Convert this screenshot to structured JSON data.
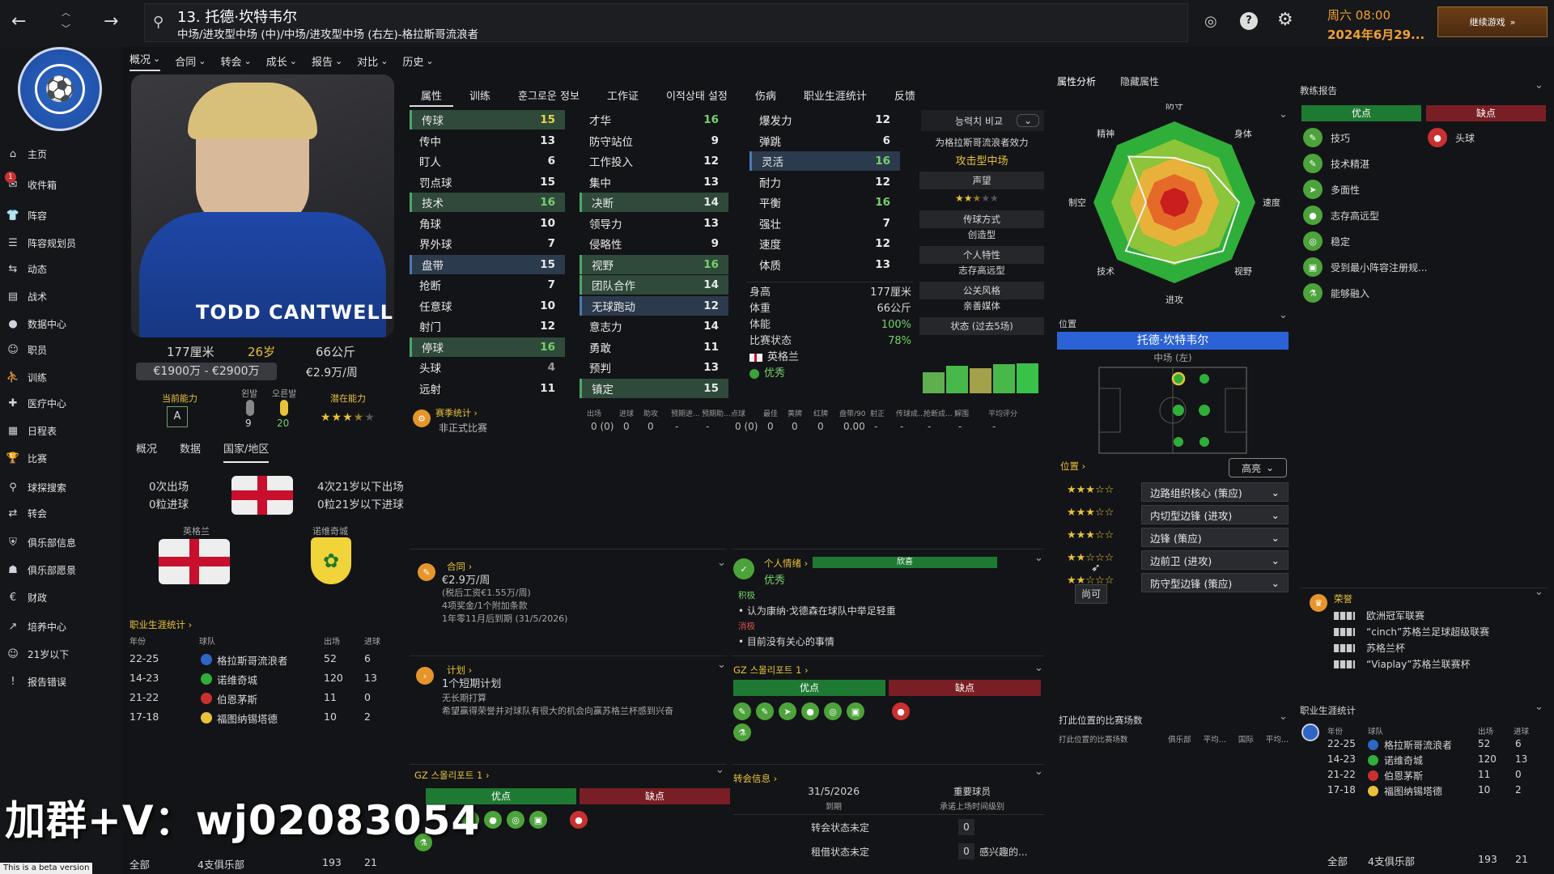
{
  "header": {
    "player_title": "13. 托德·坎特韦尔",
    "player_subtitle": "中场/进攻型中场 (中)/中场/进攻型中场 (右左)-格拉斯哥流浪者",
    "date_line1": "周六 08:00",
    "date_line2": "2024年6月29...",
    "continue_label": "继续游戏"
  },
  "nav": {
    "items": [
      "主页",
      "收件箱",
      "阵容",
      "阵容规划员",
      "动态",
      "战术",
      "数据中心",
      "职员",
      "训练",
      "医疗中心",
      "日程表",
      "比赛",
      "球探搜索",
      "转会",
      "俱乐部信息",
      "俱乐部愿景",
      "财政",
      "培养中心",
      "21岁以下",
      "报告错误"
    ],
    "inbox_badge": "1"
  },
  "menu": [
    "概况",
    "合同",
    "转会",
    "成长",
    "报告",
    "对比",
    "历史"
  ],
  "profile": {
    "height": "177厘米",
    "age": "26岁",
    "weight": "66公斤",
    "value": "€1900万 - €2900万",
    "wage": "€2.9万/周",
    "current_ability_label": "当前能力",
    "current_ability": "A",
    "left_foot_label": "왼발",
    "right_foot_label": "오른발",
    "left_foot": "9",
    "right_foot": "20",
    "potential_label": "潜在能力",
    "potential_stars": 3.5,
    "shirt_name": "TODD CANTWELL"
  },
  "subtabs": [
    "概况",
    "数据",
    "国家/地区"
  ],
  "intl": {
    "caps": "0次出场",
    "goals": "0粒进球",
    "u21_caps": "4次21岁以下出场",
    "u21_goals": "0粒21岁以下进球",
    "nation": "英格兰",
    "prev_club": "诺维奇城"
  },
  "career_left": {
    "title": "职业生涯统计",
    "headers": [
      "年份",
      "球队",
      "出场",
      "进球"
    ],
    "rows": [
      [
        "22-25",
        "格拉斯哥流浪者",
        "52",
        "6"
      ],
      [
        "14-23",
        "诺维奇城",
        "120",
        "13"
      ],
      [
        "21-22",
        "伯恩茅斯",
        "11",
        "0"
      ],
      [
        "17-18",
        "福图纳锡塔德",
        "10",
        "2"
      ]
    ],
    "total": [
      "全部",
      "4支俱乐部",
      "193",
      "21"
    ]
  },
  "attr_tabs": [
    "属性",
    "训练",
    "훈그로운 정보",
    "工作证",
    "이적상태 설정",
    "伤病",
    "职业生涯统计",
    "反馈"
  ],
  "tech": [
    [
      "传球",
      "15",
      "y"
    ],
    [
      "传中",
      "13",
      "w"
    ],
    [
      "盯人",
      "6",
      "w"
    ],
    [
      "罚点球",
      "15",
      "w"
    ],
    [
      "技术",
      "16",
      "g"
    ],
    [
      "角球",
      "10",
      "w"
    ],
    [
      "界外球",
      "7",
      "w"
    ],
    [
      "盘带",
      "15",
      "w"
    ],
    [
      "抢断",
      "7",
      "w"
    ],
    [
      "任意球",
      "10",
      "w"
    ],
    [
      "射门",
      "12",
      "w"
    ],
    [
      "停球",
      "16",
      "g"
    ],
    [
      "头球",
      "4",
      "gr"
    ],
    [
      "远射",
      "11",
      "w"
    ]
  ],
  "mental": [
    [
      "才华",
      "16",
      "g"
    ],
    [
      "防守站位",
      "9",
      "w"
    ],
    [
      "工作投入",
      "12",
      "w"
    ],
    [
      "集中",
      "13",
      "w"
    ],
    [
      "决断",
      "14",
      "w"
    ],
    [
      "领导力",
      "13",
      "w"
    ],
    [
      "侵略性",
      "9",
      "w"
    ],
    [
      "视野",
      "16",
      "g"
    ],
    [
      "团队合作",
      "14",
      "w"
    ],
    [
      "无球跑动",
      "12",
      "w"
    ],
    [
      "意志力",
      "14",
      "w"
    ],
    [
      "勇敢",
      "11",
      "w"
    ],
    [
      "预判",
      "13",
      "w"
    ],
    [
      "镇定",
      "15",
      "w"
    ]
  ],
  "physical": [
    [
      "爆发力",
      "12",
      "w"
    ],
    [
      "弹跳",
      "6",
      "w"
    ],
    [
      "灵活",
      "16",
      "g"
    ],
    [
      "耐力",
      "12",
      "w"
    ],
    [
      "平衡",
      "16",
      "g"
    ],
    [
      "强壮",
      "7",
      "w"
    ],
    [
      "速度",
      "12",
      "w"
    ],
    [
      "体质",
      "13",
      "w"
    ]
  ],
  "body": {
    "height_label": "身高",
    "height": "177厘米",
    "weight_label": "体重",
    "weight": "66公斤",
    "fitness_label": "体能",
    "fitness": "100%",
    "condition_label": "比赛状态",
    "condition": "78%",
    "nation_label": "英格兰",
    "morale": "优秀"
  },
  "side_info": {
    "compare": "능력치 비교",
    "role_text": "为格拉斯哥流浪者效力",
    "role": "攻击型中场",
    "reputation": "声望",
    "rep_stars": 2.5,
    "pass_label": "传球方式",
    "pass_value": "创造型",
    "personality_label": "个人特性",
    "personality_value": "志存高远型",
    "media_label": "公关风格",
    "media_value": "亲善媒体",
    "form_label": "状态 (过去5场)",
    "form": [
      0.55,
      0.7,
      0.65,
      0.75,
      0.78
    ]
  },
  "season": {
    "title": "赛季统计",
    "headers": [
      "出场",
      "进球",
      "助攻",
      "预期进...",
      "预期助...",
      "点球",
      "最佳",
      "黄牌",
      "红牌",
      "盘带/90",
      "射正",
      "传球成...",
      "抢断成...",
      "解围",
      "平均评分"
    ],
    "label": "非正式比赛",
    "values": [
      "0 (0)",
      "0",
      "0",
      "-",
      "-",
      "0 (0)",
      "0",
      "0",
      "0",
      "0.00",
      "-",
      "-",
      "-",
      "-",
      "-"
    ]
  },
  "contract": {
    "title": "合同",
    "wage": "€2.9万/周",
    "line1": "(税后工资€1.55万/周)",
    "line2": "4项奖金/1个附加条款",
    "line3": "1年零11月后到期 (31/5/2026)"
  },
  "personal": {
    "title": "个人情绪",
    "bar": "欣喜",
    "status": "优秀",
    "pos_label": "积极",
    "pos_item": "认为康纳·戈德森在球队中举足轻重",
    "neg_label": "消极",
    "neg_item": "目前没有关心的事情"
  },
  "plan": {
    "title": "计划",
    "value": "1个短期计划",
    "line1": "无长期打算",
    "line2": "希望赢得荣誉并对球队有很大的机会向赢苏格兰杯感到兴奋"
  },
  "gz1": {
    "title": "GZ 스몰리포트 1",
    "pros": "优点",
    "cons": "缺点"
  },
  "gz2": {
    "title": "GZ 스몰리포트 1",
    "pros": "优点",
    "cons": "缺点"
  },
  "transfer": {
    "title": "转会信息",
    "date": "31/5/2026",
    "date_label": "到期",
    "important": "重要球员",
    "important_sub": "承诺上场时间级别",
    "t1": "转会状态未定",
    "t1v": "0",
    "t2": "租借状态未定",
    "t2v": "0",
    "interest": "感兴趣的..."
  },
  "analysis": {
    "tab1": "属性分析",
    "tab2": "隐藏属性",
    "labels": [
      "防守",
      "身体",
      "速度",
      "视野",
      "进攻",
      "技术",
      "制空",
      "精神"
    ],
    "values": [
      0.55,
      0.6,
      0.8,
      0.85,
      0.75,
      0.85,
      0.35,
      0.8
    ]
  },
  "position": {
    "title": "位置",
    "player": "托德·坎特韦尔",
    "pos": "中场 (左)",
    "roles_label": "位置",
    "filter": "高亮",
    "roles": [
      [
        "边路组织核心 (策应)",
        3
      ],
      [
        "内切型边锋 (进攻)",
        3
      ],
      [
        "边锋 (策应)",
        2.5
      ],
      [
        "边前卫 (进攻)",
        2
      ],
      [
        "防守型边锋 (策应)",
        1.5
      ]
    ],
    "tooltip": "尚可"
  },
  "pos_games": {
    "title": "打此位置的比赛场数",
    "cols": [
      "打此位置的比赛场数",
      "俱乐部",
      "平均...",
      "国际",
      "平均..."
    ]
  },
  "coach": {
    "title": "教练报告",
    "pros": "优点",
    "cons": "缺点",
    "pros_items": [
      "技巧",
      "技术精湛",
      "多面性",
      "志存高远型",
      "稳定",
      "受到最小阵容注册规...",
      "能够融入"
    ],
    "cons_items": [
      "头球"
    ]
  },
  "trophies": {
    "title": "荣誉",
    "items": [
      "欧洲冠军联赛",
      "“cinch”苏格兰足球超级联赛",
      "苏格兰杯",
      "“Viaplay”苏格兰联赛杯"
    ]
  },
  "career_right": {
    "title": "职业生涯统计",
    "headers": [
      "年份",
      "球队",
      "出场",
      "进球"
    ],
    "rows": [
      [
        "22-25",
        "格拉斯哥流浪者",
        "52",
        "6"
      ],
      [
        "14-23",
        "诺维奇城",
        "120",
        "13"
      ],
      [
        "21-22",
        "伯恩茅斯",
        "11",
        "0"
      ],
      [
        "17-18",
        "福图纳锡塔德",
        "10",
        "2"
      ]
    ],
    "total": [
      "全部",
      "4支俱乐部",
      "193",
      "21"
    ]
  },
  "watermark": "加群+V：wj02083054",
  "beta": "This is a beta version"
}
